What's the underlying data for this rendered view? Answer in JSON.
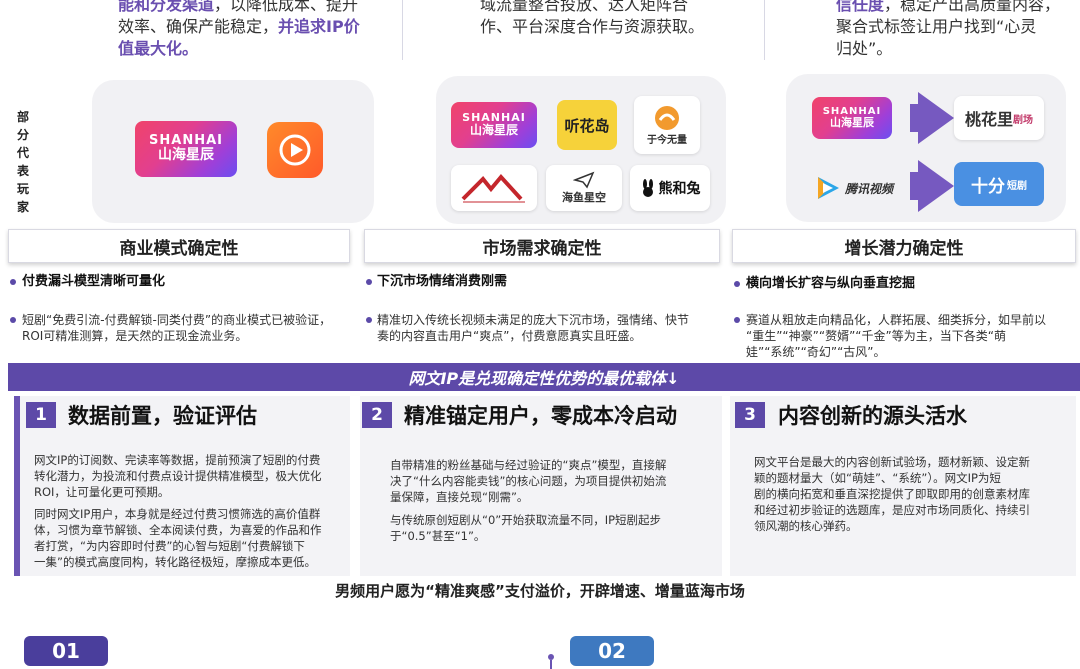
{
  "top": {
    "col1": {
      "l1a": "能和分发渠道",
      "l1b": "，以降低成本、提升",
      "l2a": "效率、确保产能稳定，",
      "l2b": "并追求IP价",
      "l3": "值最大化。"
    },
    "col2": {
      "l1": "域流量整合投放、达人矩阵合",
      "l2": "作、平台深度合作与资源获取。"
    },
    "col3": {
      "l1a": "信任度",
      "l1b": "，稳定产出高质量内容，",
      "l2": "聚合式标签让用户找到“心灵",
      "l3": "归处”。"
    }
  },
  "players_label": "部分代表玩家",
  "players": {
    "shanhai_en": "SHANHAI",
    "shanhai_zh": "山海星辰",
    "tinghuadao": "听花岛",
    "yujinwuliang": "于今无量",
    "haiyuxingkong": "海鱼星空",
    "xionghetu": "熊和兔",
    "taohuali": "桃花里",
    "taohuali_suffix": "剧场",
    "tengxun": "腾讯视频",
    "shifen": "十分",
    "shifen_suffix": "短剧"
  },
  "sections": [
    {
      "title": "商业模式确定性",
      "bold": "付费漏斗模型清晰可量化",
      "text1": "短剧“免费引流-付费解锁-同类付费”的商业模式已被验证，",
      "text2": "ROI可精准测算，是天然的正现金流业务。"
    },
    {
      "title": "市场需求确定性",
      "bold": "下沉市场情绪消费刚需",
      "text1": "精准切入传统长视频未满足的庞大下沉市场，强情绪、快节",
      "text2": "奏的内容直击用户“爽点”，付费意愿真实且旺盛。"
    },
    {
      "title": "增长潜力确定性",
      "bold": "横向增长扩容与纵向垂直挖掘",
      "text1": "赛道从粗放走向精品化，人群拓展、细类拆分，如早前以",
      "text2": "“重生”“神豪”“赘婿”“千金”等为主，当下各类“萌",
      "text3": "娃”“系统”“奇幻”“古风”。"
    }
  ],
  "banner": "网文IP是兑现确定性优势的最优载体↓",
  "cards": [
    {
      "num": "1",
      "title": "数据前置，验证评估",
      "p1": [
        "网文IP的订阅数、完读率等数据，提前预演了短剧的付费",
        "转化潜力，为投流和付费点设计提供精准模型，极大优化",
        "ROI，让可量化更可预期。"
      ],
      "p2": [
        "同时网文IP用户，本身就是经过付费习惯筛选的高价值群",
        "体，习惯为章节解锁、全本阅读付费，为喜爱的作品和作",
        "者打赏，“为内容即时付费”的心智与短剧“付费解锁下",
        "一集”的模式高度同构，转化路径极短，摩擦成本更低。"
      ]
    },
    {
      "num": "2",
      "title": "精准锚定用户，零成本冷启动",
      "p1": [
        "自带精准的粉丝基础与经过验证的“爽点”模型，直接解",
        "决了“什么内容能卖钱”的核心问题，为项目提供初始流",
        "量保障，直接兑现“刚需”。"
      ],
      "p2": [
        "与传统原创短剧从“0”开始获取流量不同，IP短剧起步",
        "于“0.5”甚至“1”。"
      ]
    },
    {
      "num": "3",
      "title": "内容创新的源头活水",
      "p1": [
        "网文平台是最大的内容创新试验场，题材新颖、设定新",
        "颖的题材量大（如“萌娃”、“系统”）。网文IP为短",
        "剧的横向拓宽和垂直深挖提供了即取即用的创意素材库",
        "和经过初步验证的选题库，是应对市场同质化、持续引",
        "领风潮的核心弹药。"
      ]
    }
  ],
  "subtitle": "男频用户愿为“精准爽感”支付溢价，开辟增速、增量蓝海市场",
  "pills": [
    "01",
    "02"
  ]
}
